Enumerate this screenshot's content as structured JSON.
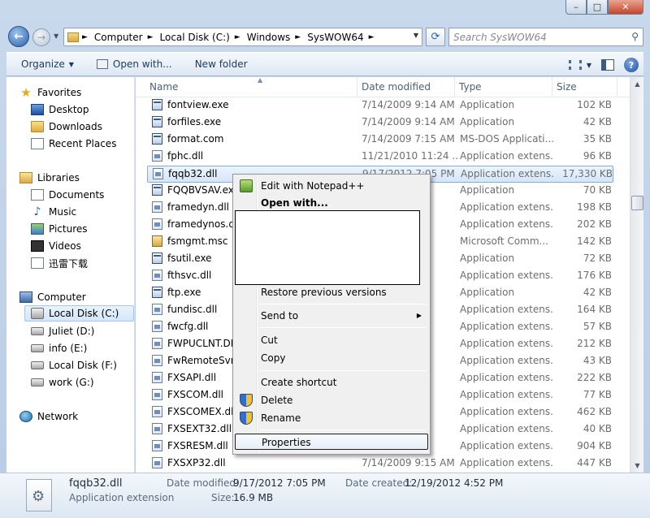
{
  "window": {
    "caption_buttons": [
      "–",
      "□",
      "✕"
    ]
  },
  "nav": {
    "back_icon": "back-arrow-icon",
    "forward_icon": "forward-arrow-icon",
    "breadcrumbs": [
      "Computer",
      "Local Disk (C:)",
      "Windows",
      "SysWOW64"
    ],
    "search_placeholder": "Search SysWOW64"
  },
  "toolbar": {
    "organize": "Organize",
    "open_with": "Open with...",
    "new_folder": "New folder"
  },
  "sidebar": {
    "favorites_title": "Favorites",
    "favorites": [
      "Desktop",
      "Downloads",
      "Recent Places"
    ],
    "libraries_title": "Libraries",
    "libraries": [
      "Documents",
      "Music",
      "Pictures",
      "Videos",
      "迅雷下载"
    ],
    "computer_title": "Computer",
    "drives": [
      "Local Disk (C:)",
      "Juliet (D:)",
      "info (E:)",
      "Local Disk (F:)",
      "work (G:)"
    ],
    "network_title": "Network"
  },
  "columns": {
    "name": "Name",
    "date": "Date modified",
    "type": "Type",
    "size": "Size"
  },
  "files": [
    {
      "name": "fontview.exe",
      "date": "7/14/2009 9:14 AM",
      "type": "Application",
      "size": "102 KB",
      "icon": "exe"
    },
    {
      "name": "forfiles.exe",
      "date": "7/14/2009 9:14 AM",
      "type": "Application",
      "size": "42 KB",
      "icon": "exe"
    },
    {
      "name": "format.com",
      "date": "7/14/2009 7:15 AM",
      "type": "MS-DOS Applicati...",
      "size": "35 KB",
      "icon": "exe"
    },
    {
      "name": "fphc.dll",
      "date": "11/21/2010 11:24 ...",
      "type": "Application extens...",
      "size": "96 KB",
      "icon": "dll"
    },
    {
      "name": "fqqb32.dll",
      "date": "9/17/2012 7:05 PM",
      "type": "Application extens...",
      "size": "17,330 KB",
      "icon": "dll"
    },
    {
      "name": "FQQBVSAV.exe",
      "date": "",
      "type": "Application",
      "size": "70 KB",
      "icon": "exe"
    },
    {
      "name": "framedyn.dll",
      "date": "",
      "type": "Application extens...",
      "size": "198 KB",
      "icon": "dll"
    },
    {
      "name": "framedynos.dll",
      "date": "",
      "type": "Application extens...",
      "size": "202 KB",
      "icon": "dll"
    },
    {
      "name": "fsmgmt.msc",
      "date": "",
      "type": "Microsoft Comm...",
      "size": "142 KB",
      "icon": "msc"
    },
    {
      "name": "fsutil.exe",
      "date": "",
      "type": "Application",
      "size": "72 KB",
      "icon": "exe"
    },
    {
      "name": "fthsvc.dll",
      "date": "",
      "type": "Application extens...",
      "size": "176 KB",
      "icon": "dll"
    },
    {
      "name": "ftp.exe",
      "date": "",
      "type": "Application",
      "size": "42 KB",
      "icon": "exe"
    },
    {
      "name": "fundisc.dll",
      "date": "",
      "type": "Application extens...",
      "size": "164 KB",
      "icon": "dll"
    },
    {
      "name": "fwcfg.dll",
      "date": "",
      "type": "Application extens...",
      "size": "57 KB",
      "icon": "dll"
    },
    {
      "name": "FWPUCLNT.DLL",
      "date": "",
      "type": "Application extens...",
      "size": "212 KB",
      "icon": "dll"
    },
    {
      "name": "FwRemoteSvr.dll",
      "date": "",
      "type": "Application extens...",
      "size": "43 KB",
      "icon": "dll"
    },
    {
      "name": "FXSAPI.dll",
      "date": "",
      "type": "Application extens...",
      "size": "222 KB",
      "icon": "dll"
    },
    {
      "name": "FXSCOM.dll",
      "date": "",
      "type": "Application extens...",
      "size": "77 KB",
      "icon": "dll"
    },
    {
      "name": "FXSCOMEX.dll",
      "date": "",
      "type": "Application extens...",
      "size": "462 KB",
      "icon": "dll"
    },
    {
      "name": "FXSEXT32.dll",
      "date": "",
      "type": "Application extens...",
      "size": "40 KB",
      "icon": "dll"
    },
    {
      "name": "FXSRESM.dll",
      "date": "",
      "type": "Application extens...",
      "size": "904 KB",
      "icon": "dll"
    },
    {
      "name": "FXSXP32.dll",
      "date": "7/14/2009 9:15 AM",
      "type": "Application extens...",
      "size": "447 KB",
      "icon": "dll"
    }
  ],
  "context_menu": {
    "edit_notepad": "Edit with Notepad++",
    "open_with": "Open with...",
    "restore": "Restore previous versions",
    "send_to": "Send to",
    "cut": "Cut",
    "copy": "Copy",
    "create_shortcut": "Create shortcut",
    "delete": "Delete",
    "rename": "Rename",
    "properties": "Properties"
  },
  "details": {
    "name": "fqqb32.dll",
    "type": "Application extension",
    "modified_label": "Date modified:",
    "modified_value": "9/17/2012 7:05 PM",
    "size_label": "Size:",
    "size_value": "16.9 MB",
    "created_label": "Date created:",
    "created_value": "12/19/2012 4:52 PM"
  },
  "colors": {
    "accent": "#1e395b",
    "selection": "#d4e6fa"
  }
}
